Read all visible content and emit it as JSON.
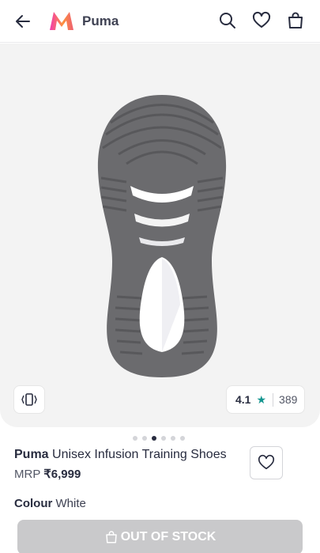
{
  "header": {
    "title": "Puma",
    "back_icon": "arrow-left-icon",
    "logo_icon": "myntra-logo-icon",
    "search_icon": "search-icon",
    "wishlist_icon": "heart-icon",
    "bag_icon": "shopping-bag-icon"
  },
  "gallery": {
    "image_count": 6,
    "active_index": 2,
    "vr_icon": "rotate-view-icon",
    "rating": {
      "value": "4.1",
      "star": "★",
      "count": "389",
      "color": "#14958f"
    }
  },
  "product": {
    "brand": "Puma",
    "name": "Unisex Infusion Training Shoes",
    "mrp_label": "MRP",
    "price": "₹6,999",
    "colour_label": "Colour",
    "colour_value": "White"
  },
  "cta": {
    "label": "OUT OF STOCK",
    "icon": "shopping-bag-icon",
    "disabled": true
  }
}
